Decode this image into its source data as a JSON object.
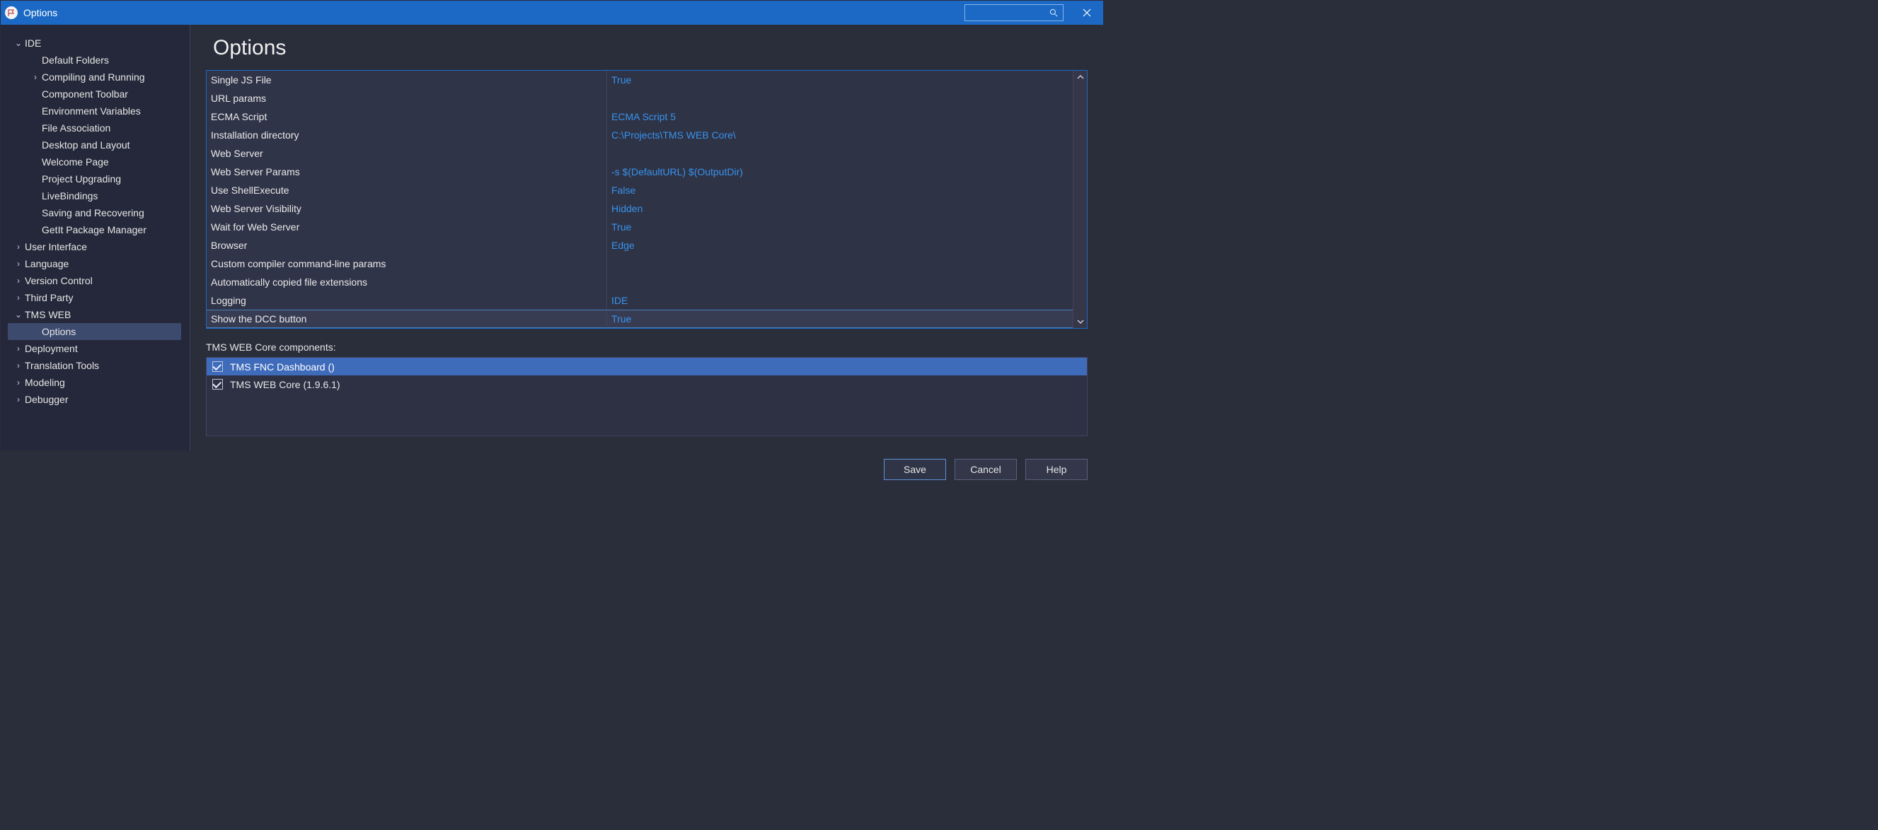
{
  "window": {
    "title": "Options"
  },
  "page": {
    "title": "Options"
  },
  "tree": {
    "ide": {
      "label": "IDE"
    },
    "ide_defaultFolders": {
      "label": "Default Folders"
    },
    "ide_compilingRunning": {
      "label": "Compiling and Running"
    },
    "ide_componentToolbar": {
      "label": "Component Toolbar"
    },
    "ide_envVars": {
      "label": "Environment Variables"
    },
    "ide_fileAssoc": {
      "label": "File Association"
    },
    "ide_desktopLayout": {
      "label": "Desktop and Layout"
    },
    "ide_welcomePage": {
      "label": "Welcome Page"
    },
    "ide_projectUpgrading": {
      "label": "Project Upgrading"
    },
    "ide_liveBindings": {
      "label": "LiveBindings"
    },
    "ide_savingRecovering": {
      "label": "Saving and Recovering"
    },
    "ide_getit": {
      "label": "GetIt Package Manager"
    },
    "userInterface": {
      "label": "User Interface"
    },
    "language": {
      "label": "Language"
    },
    "versionControl": {
      "label": "Version Control"
    },
    "thirdParty": {
      "label": "Third Party"
    },
    "tmsWeb": {
      "label": "TMS WEB"
    },
    "tmsWeb_options": {
      "label": "Options"
    },
    "deployment": {
      "label": "Deployment"
    },
    "translationTools": {
      "label": "Translation Tools"
    },
    "modeling": {
      "label": "Modeling"
    },
    "debugger": {
      "label": "Debugger"
    }
  },
  "settings": [
    {
      "name": "Single JS File",
      "value": "True"
    },
    {
      "name": "URL params",
      "value": ""
    },
    {
      "name": "ECMA Script",
      "value": "ECMA Script 5"
    },
    {
      "name": "Installation directory",
      "value": "C:\\Projects\\TMS WEB Core\\"
    },
    {
      "name": "Web Server",
      "value": ""
    },
    {
      "name": "Web Server Params",
      "value": "-s $(DefaultURL) $(OutputDir)"
    },
    {
      "name": "Use ShellExecute",
      "value": "False"
    },
    {
      "name": "Web Server Visibility",
      "value": "Hidden"
    },
    {
      "name": "Wait for Web Server",
      "value": "True"
    },
    {
      "name": "Browser",
      "value": "Edge"
    },
    {
      "name": "Custom compiler command-line params",
      "value": ""
    },
    {
      "name": "Automatically copied file extensions",
      "value": ""
    },
    {
      "name": "Logging",
      "value": "IDE"
    },
    {
      "name": "Show the DCC button",
      "value": "True"
    }
  ],
  "componentsLabel": "TMS WEB Core components:",
  "components": [
    {
      "label": "TMS FNC Dashboard ()",
      "checked": true,
      "selected": true
    },
    {
      "label": "TMS WEB Core (1.9.6.1)",
      "checked": true,
      "selected": false
    }
  ],
  "buttons": {
    "save": "Save",
    "cancel": "Cancel",
    "help": "Help"
  }
}
